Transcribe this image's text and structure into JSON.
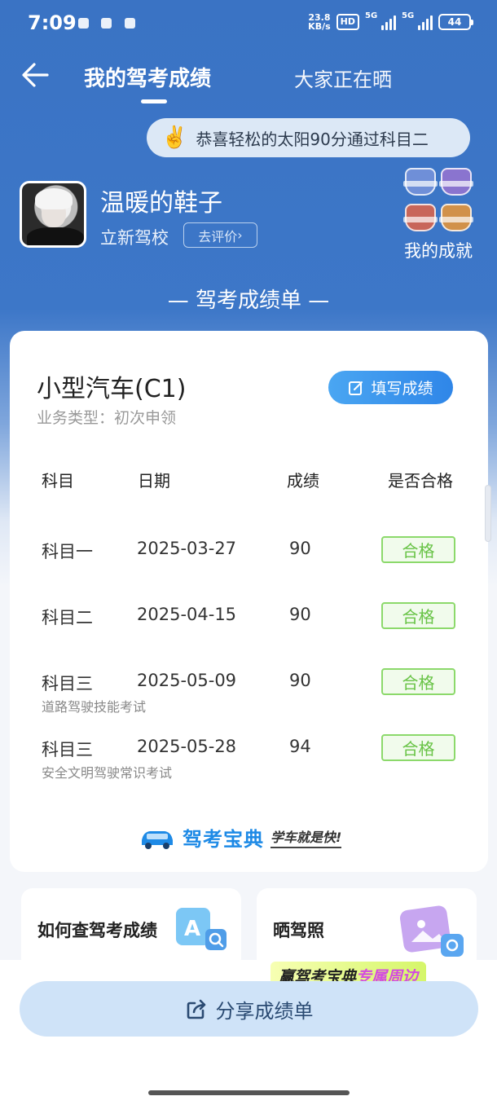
{
  "status_bar": {
    "time": "7:09",
    "net_speed_value": "23.8",
    "net_speed_unit": "KB/s",
    "hd_label": "HD",
    "signal_label_1": "5G",
    "signal_label_2": "5G",
    "battery": "44"
  },
  "nav": {
    "tab_mine": "我的驾考成绩",
    "tab_everyone": "大家正在晒"
  },
  "congrats": {
    "icon": "victory-hand-icon",
    "text": "恭喜轻松的太阳90分通过科目二"
  },
  "profile": {
    "name": "温暖的鞋子",
    "school": "立新驾校",
    "rate_label": "去评价",
    "achievements_label": "我的成就"
  },
  "section_title": "— 驾考成绩单 —",
  "card": {
    "car_type": "小型汽车(C1)",
    "biz_type": "业务类型：初次申领",
    "fill_label": "填写成绩",
    "headers": [
      "科目",
      "日期",
      "成绩",
      "是否合格"
    ],
    "rows": [
      {
        "subject": "科目一",
        "date": "2025-03-27",
        "score": "90",
        "status": "合格",
        "sub": ""
      },
      {
        "subject": "科目二",
        "date": "2025-04-15",
        "score": "90",
        "status": "合格",
        "sub": ""
      },
      {
        "subject": "科目三",
        "date": "2025-05-09",
        "score": "90",
        "status": "合格",
        "sub": "道路驾驶技能考试"
      },
      {
        "subject": "科目三",
        "date": "2025-05-28",
        "score": "94",
        "status": "合格",
        "sub": "安全文明驾驶常识考试"
      }
    ],
    "brand_name": "驾考宝典",
    "brand_slogan": "学车就是快!"
  },
  "tiles": {
    "left_title": "如何查驾考成绩",
    "right_title": "晒驾照"
  },
  "promo": {
    "prefix": "赢驾考宝典",
    "highlight": "专属周边"
  },
  "share_label": "分享成绩单",
  "colors": {
    "header_blue": "#3a73c4",
    "accent_blue": "#2f86e8",
    "pass_green": "#68c346"
  }
}
